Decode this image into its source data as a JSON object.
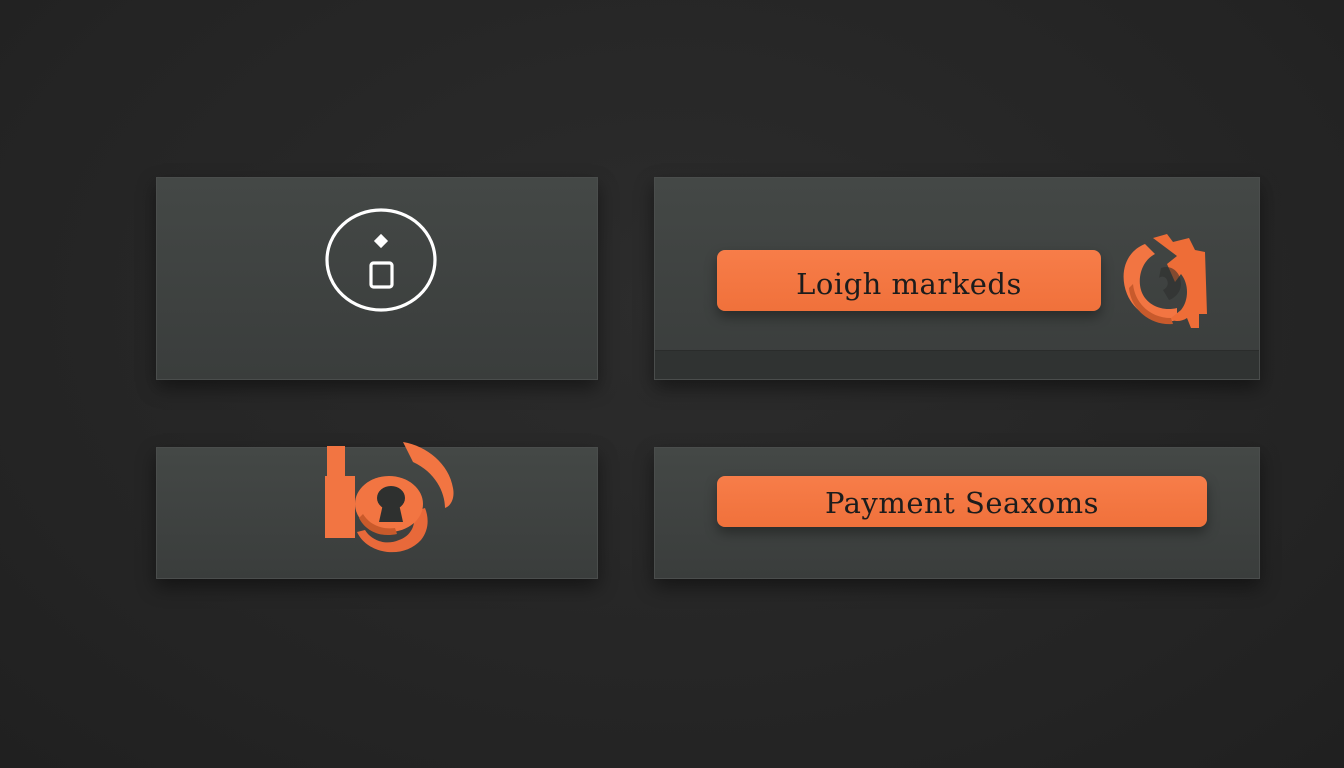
{
  "panels": {
    "top_right": {
      "button_label": "Loigh markeds",
      "icon": "refresh-icon"
    },
    "top_left": {
      "icon": "info-icon"
    },
    "bottom_left": {
      "icon": "lock-icon"
    },
    "bottom_right": {
      "button_label": "Payment Seaxoms"
    }
  },
  "colors": {
    "accent": "#f27542",
    "panel": "#3f4241",
    "background": "#262626",
    "icon_stroke": "#f2f2f2"
  }
}
